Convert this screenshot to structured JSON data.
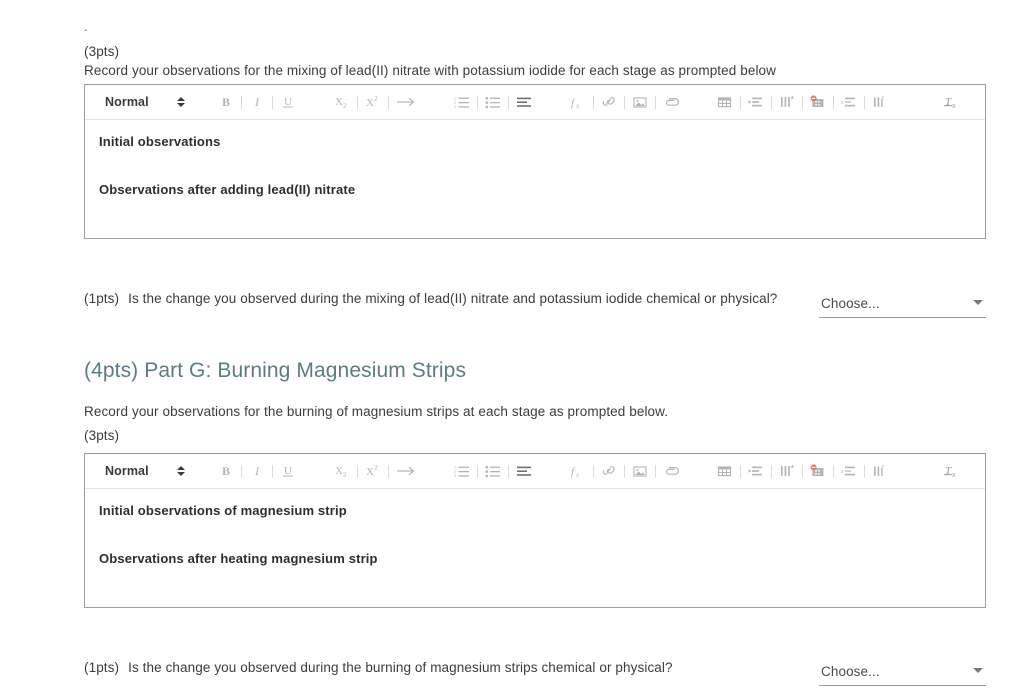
{
  "document": {
    "leading_mark": "."
  },
  "sections": [
    {
      "points_label": "(3pts)",
      "prompt": "Record your observations for the mixing of lead(II) nitrate with potassium iodide for each stage as prompted below",
      "editor": {
        "style_select": "Normal",
        "lines": [
          "Initial observations",
          "Observations after adding lead(II) nitrate"
        ]
      },
      "question": {
        "points": "(1pts)",
        "text": "Is the change you observed during the mixing of lead(II) nitrate and potassium iodide chemical or physical?",
        "dropdown_value": "Choose..."
      }
    },
    {
      "heading": "(4pts) Part G: Burning Magnesium Strips",
      "prompt": "Record your observations for the burning of magnesium strips at each stage as prompted below.",
      "points_label": "(3pts)",
      "editor": {
        "style_select": "Normal",
        "lines": [
          "Initial observations of magnesium strip",
          "Observations after heating magnesium strip"
        ]
      },
      "question": {
        "points": "(1pts)",
        "text": "Is the change you observed during the burning of magnesium strips chemical or physical?",
        "dropdown_value": "Choose..."
      }
    }
  ],
  "toolbar": {
    "icons": [
      "bold-icon",
      "italic-icon",
      "underline-icon",
      "subscript-icon",
      "superscript-icon",
      "indent-arrow-icon",
      "ordered-list-icon",
      "bullet-list-icon",
      "align-icon",
      "formula-icon",
      "link-icon",
      "image-icon",
      "attachment-icon",
      "insert-table-icon",
      "insert-row-icon",
      "insert-column-icon",
      "delete-table-icon",
      "delete-row-icon",
      "delete-column-icon",
      "clear-formatting-icon"
    ]
  },
  "colors": {
    "heading": "#5f7c7c",
    "body_text": "#3c3c3c",
    "editor_border": "#9e9e9e",
    "icon_gray": "#b4b4b4",
    "delete_accent": "#e8796f"
  }
}
